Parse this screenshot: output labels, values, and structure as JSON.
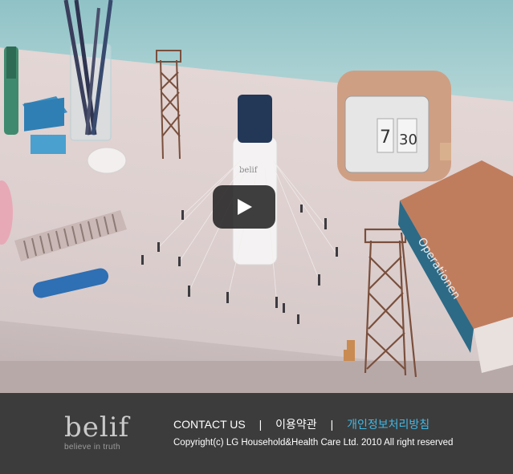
{
  "video": {
    "play_button_label": "play-icon",
    "clock_digits": [
      "7",
      "30"
    ],
    "book_spine_text": "Operationen"
  },
  "brand": {
    "logo_text": "belif",
    "tagline": "believe in truth"
  },
  "footer": {
    "links": [
      {
        "label": "CONTACT US"
      },
      {
        "label": "이용약관"
      },
      {
        "label": "개인정보처리방침"
      }
    ],
    "separator": "|",
    "copyright": "Copyright(c) LG Household&Health Care Ltd. 2010 All right reserved"
  },
  "colors": {
    "footer_bg": "#3c3c3c",
    "privacy_link": "#41b8e3",
    "play_button_bg": "#1f1f1f"
  }
}
